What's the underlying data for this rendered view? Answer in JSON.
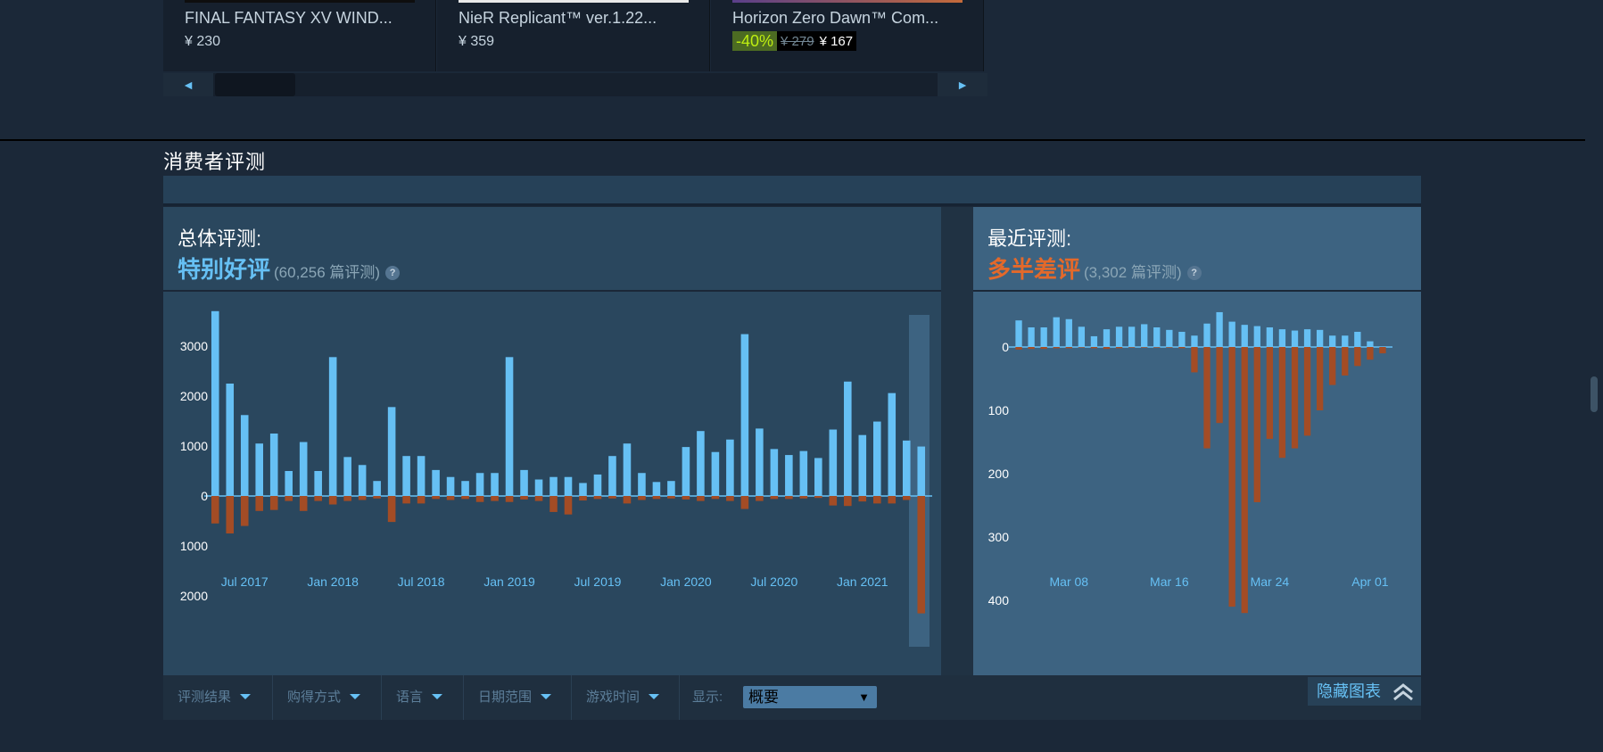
{
  "carousel": {
    "items": [
      {
        "title": "FINAL FANTASY XV WIND...",
        "price": "¥ 230"
      },
      {
        "title": "NieR Replicant™ ver.1.22...",
        "price": "¥ 359"
      },
      {
        "title": "Horizon Zero Dawn™ Com...",
        "discount": "-40%",
        "original_price": "¥ 279",
        "final_price": "¥ 167"
      }
    ],
    "prev_glyph": "◄",
    "next_glyph": "►"
  },
  "section_title": "消费者评测",
  "overall": {
    "label": "总体评测:",
    "summary": "特别好评",
    "summary_color": "#66c0f4",
    "count": "(60,256 篇评测)",
    "help": "?"
  },
  "recent": {
    "label": "最近评测:",
    "summary": "多半差评",
    "summary_color": "#e4692a",
    "count": "(3,302 篇评测)",
    "help": "?"
  },
  "filters": [
    {
      "label": "评测结果"
    },
    {
      "label": "购得方式"
    },
    {
      "label": "语言"
    },
    {
      "label": "日期范围"
    },
    {
      "label": "游戏时间"
    }
  ],
  "display": {
    "label": "显示:",
    "value": "概要"
  },
  "hide_graph": {
    "label": "隐藏图表",
    "icon": "double-chevron-up-icon"
  },
  "colors": {
    "positive": "#66c0f4",
    "negative": "#a34c25"
  },
  "chart_data": [
    {
      "type": "bar",
      "title": "",
      "ytick_labels_top": [
        "3000",
        "2000",
        "1000",
        "0"
      ],
      "ytick_labels_bottom": [
        "1000",
        "2000"
      ],
      "ylim": [
        -2500,
        3900
      ],
      "xtick_labels": [
        "Jul 2017",
        "Jan 2018",
        "Jul 2018",
        "Jan 2019",
        "Jul 2019",
        "Jan 2020",
        "Jul 2020",
        "Jan 2021"
      ],
      "xtick_index": [
        2,
        8,
        14,
        20,
        26,
        32,
        38,
        44
      ],
      "series": [
        {
          "name": "positive",
          "values": [
            3700,
            2250,
            1620,
            1050,
            1250,
            500,
            1080,
            500,
            2780,
            780,
            620,
            300,
            1780,
            800,
            800,
            520,
            380,
            300,
            460,
            460,
            2780,
            520,
            330,
            380,
            380,
            260,
            430,
            800,
            1050,
            460,
            280,
            300,
            980,
            1300,
            880,
            1130,
            3240,
            1350,
            940,
            820,
            900,
            760,
            1330,
            2290,
            1220,
            1490,
            2060,
            1110,
            990
          ]
        },
        {
          "name": "negative",
          "values": [
            -550,
            -750,
            -600,
            -300,
            -280,
            -100,
            -300,
            -100,
            -170,
            -100,
            -80,
            -50,
            -520,
            -150,
            -150,
            -60,
            -80,
            -60,
            -120,
            -100,
            -120,
            -70,
            -100,
            -320,
            -370,
            -90,
            -60,
            -50,
            -150,
            -80,
            -60,
            -50,
            -70,
            -100,
            -60,
            -100,
            -260,
            -100,
            -60,
            -60,
            -50,
            -40,
            -190,
            -200,
            -110,
            -150,
            -150,
            -80,
            -2350
          ]
        }
      ]
    },
    {
      "type": "bar",
      "title": "",
      "ytick_labels": [
        "0",
        "100",
        "200",
        "300",
        "400"
      ],
      "ylim": [
        -55,
        420
      ],
      "xtick_labels": [
        "Mar 08",
        "Mar 16",
        "Mar 24",
        "Apr 01"
      ],
      "xtick_index": [
        4,
        12,
        20,
        28
      ],
      "series": [
        {
          "name": "positive",
          "values": [
            42,
            31,
            31,
            47,
            44,
            32,
            17,
            28,
            32,
            32,
            36,
            31,
            27,
            24,
            18,
            37,
            55,
            40,
            35,
            33,
            31,
            28,
            26,
            28,
            27,
            18,
            18,
            24,
            9
          ]
        },
        {
          "name": "negative",
          "values": [
            -4,
            -3,
            -3,
            -2,
            -2,
            -1,
            -2,
            -3,
            -2,
            -1,
            -1,
            -1,
            -1,
            -2,
            -40,
            -160,
            -120,
            -410,
            -420,
            -245,
            -145,
            -175,
            -160,
            -140,
            -100,
            -60,
            -45,
            -30,
            -20,
            -10
          ]
        }
      ]
    }
  ]
}
